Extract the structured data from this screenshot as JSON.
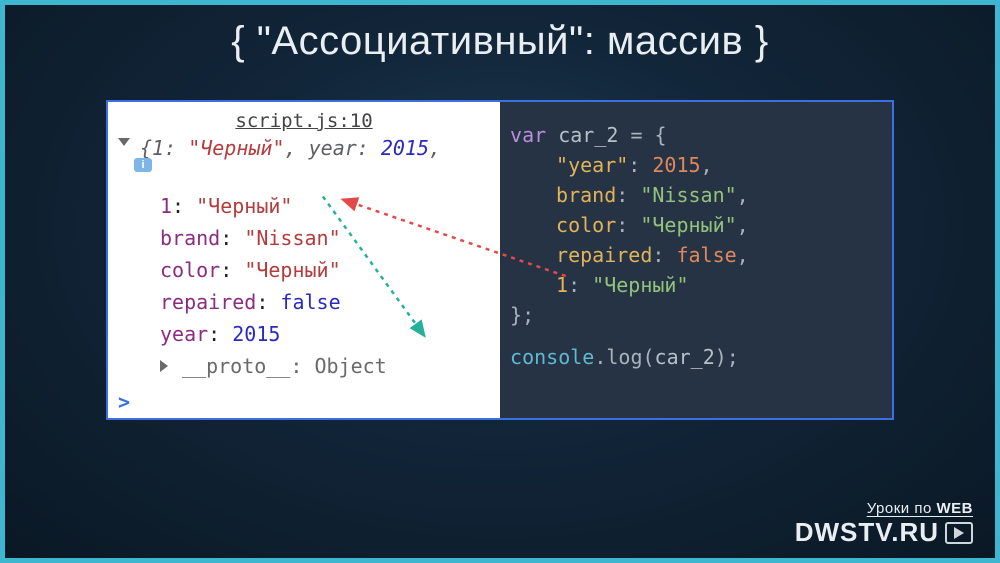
{
  "title": "{ \"Ассоциативный\": массив }",
  "left": {
    "scriptlink": "script.js:10",
    "preview_prefix": "{",
    "preview_k1": "1:",
    "preview_v1": "\"Черный\"",
    "preview_sep": ", ",
    "preview_k2": "year:",
    "preview_v2": "2015",
    "preview_suffix": ",",
    "badge": "i",
    "lines": [
      {
        "k": "1",
        "sep": ": ",
        "v": "\"Черный\"",
        "t": "s"
      },
      {
        "k": "brand",
        "sep": ": ",
        "v": "\"Nissan\"",
        "t": "s"
      },
      {
        "k": "color",
        "sep": ": ",
        "v": "\"Черный\"",
        "t": "s"
      },
      {
        "k": "repaired",
        "sep": ": ",
        "v": "false",
        "t": "b"
      },
      {
        "k": "year",
        "sep": ": ",
        "v": "2015",
        "t": "n"
      }
    ],
    "proto_key": "__proto__",
    "proto_sep": ": ",
    "proto_val": "Object",
    "prompt": ">"
  },
  "right": {
    "l1_kw": "var ",
    "l1_v": "car_2 ",
    "l1_eq": "= {",
    "lines": [
      {
        "k": "\"year\"",
        "sep": ": ",
        "v": "2015",
        "t": "n",
        "c": ","
      },
      {
        "k": "brand",
        "sep": ": ",
        "v": "\"Nissan\"",
        "t": "s",
        "c": ","
      },
      {
        "k": "color",
        "sep": ": ",
        "v": "\"Черный\"",
        "t": "s",
        "c": ","
      },
      {
        "k": "repaired",
        "sep": ": ",
        "v": "false",
        "t": "b",
        "c": ","
      },
      {
        "k": "1",
        "sep": ": ",
        "v": "\"Черный\"",
        "t": "s",
        "c": ""
      }
    ],
    "close": "};",
    "log_fn": "console",
    "log_dot": ".log(",
    "log_arg": "car_2",
    "log_end": ");"
  },
  "watermark": {
    "small_a": "Уроки",
    "small_b": " по ",
    "small_c": "WEB",
    "big": "DWSTV.RU"
  }
}
